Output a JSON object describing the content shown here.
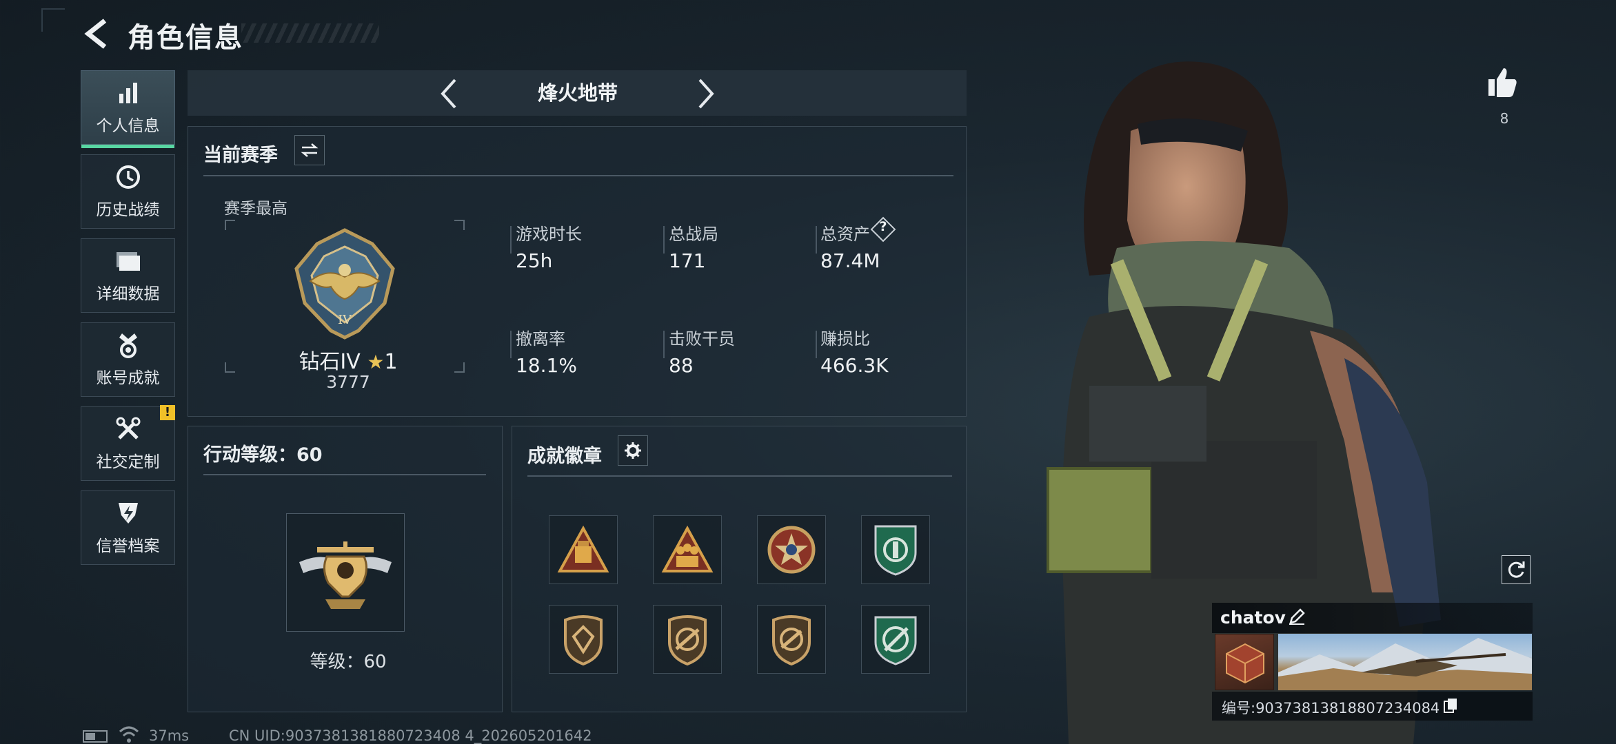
{
  "header": {
    "title": "角色信息"
  },
  "sidebar": {
    "items": [
      {
        "label": "个人信息",
        "icon": "bar-chart-icon",
        "active": true
      },
      {
        "label": "历史战绩",
        "icon": "history-clock-icon"
      },
      {
        "label": "详细数据",
        "icon": "folder-icon"
      },
      {
        "label": "账号成就",
        "icon": "medal-icon"
      },
      {
        "label": "社交定制",
        "icon": "tools-icon",
        "badge": "!"
      },
      {
        "label": "信誉档案",
        "icon": "shield-bolt-icon"
      }
    ]
  },
  "mode": {
    "title": "烽火地带"
  },
  "season": {
    "title": "当前赛季",
    "best_label": "赛季最高",
    "rank_name": "钻石IV",
    "rank_stars": "1",
    "rank_score": "3777",
    "stats": [
      {
        "label": "游戏时长",
        "value": "25h"
      },
      {
        "label": "总战局",
        "value": "171"
      },
      {
        "label": "总资产",
        "value": "87.4M",
        "help": "?"
      },
      {
        "label": "撤离率",
        "value": "18.1%"
      },
      {
        "label": "击败干员",
        "value": "88"
      },
      {
        "label": "赚损比",
        "value": "466.3K"
      }
    ]
  },
  "level": {
    "title": "行动等级：60",
    "label": "等级：60"
  },
  "achievements": {
    "title": "成就徽章"
  },
  "profile": {
    "likes": "8",
    "name": "chatov",
    "id_text": "编号:9037381381880723408​4"
  },
  "footer": {
    "ping": "37ms",
    "uid": "CN UID:9037381381880723408 4_202605201642"
  },
  "colors": {
    "accent": "#58d6a2",
    "alert": "#f0c028"
  }
}
